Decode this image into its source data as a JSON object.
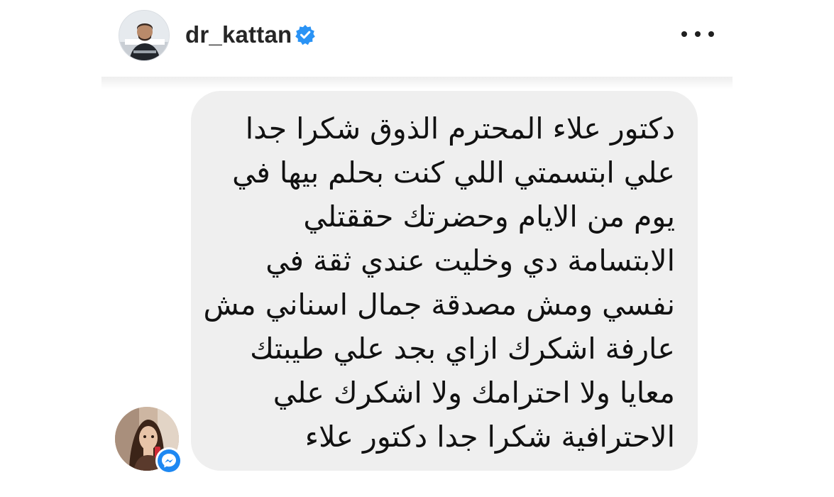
{
  "header": {
    "username": "dr_kattan",
    "verified_icon": "verified-badge-icon",
    "more_icon": "more-horizontal-icon",
    "verified_color": "#2a93f5"
  },
  "message": {
    "lines": [
      "دكتور علاء المحترم الذوق شكرا جدا",
      "علي ابتسمتي اللي كنت بحلم بيها في",
      "يوم من الايام وحضرتك حققتلي",
      "الابتسامة دي وخليت عندي ثقة في",
      "نفسي ومش مصدقة جمال اسناني مش",
      "عارفة اشكرك ازاي بجد علي طيبتك",
      "معايا ولا احترامك ولا اشكرك علي",
      "الاحترافية شكرا جدا دكتور علاء"
    ],
    "bubble_color": "#efefef"
  },
  "sender": {
    "avatar_icon": "sender-avatar",
    "badge_icon": "messenger-icon",
    "badge_color": "#1e88f2"
  }
}
